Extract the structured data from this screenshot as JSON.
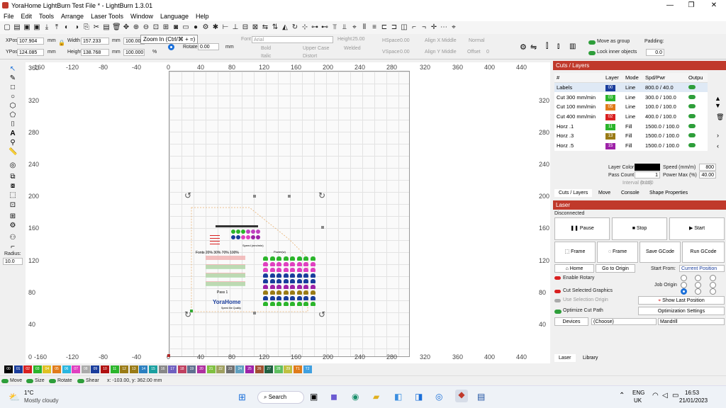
{
  "window": {
    "title": "YoraHome LightBurn Test File * - LightBurn 1.3.01"
  },
  "menu": [
    "File",
    "Edit",
    "Tools",
    "Arrange",
    "Laser Tools",
    "Window",
    "Language",
    "Help"
  ],
  "tooltip": "Zoom In (Ctrl/⌘ + =)",
  "props": {
    "xpos_label": "XPos",
    "xpos": "107.904",
    "ypos_label": "YPos",
    "ypos": "124.085",
    "unit": "mm",
    "width_label": "Width",
    "width": "157.233",
    "height_label": "Height",
    "height": "138.768",
    "pct1": "100.000",
    "pct2": "100.000",
    "pct_sign": "%",
    "rotate_label": "Rotate",
    "rotate": "0.00",
    "font_label": "Font",
    "font": "Arial",
    "height2_label": "Height",
    "height2": "25.00",
    "bold": "Bold",
    "italic": "Italic",
    "uppercase": "Upper Case",
    "distort": "Distort",
    "welded": "Welded",
    "hspace_label": "HSpace",
    "hspace": "0.00",
    "vspace_label": "VSpace",
    "vspace": "0.00",
    "alignx_label": "Align X",
    "alignx": "Middle",
    "aligny_label": "Align Y",
    "aligny": "Middle",
    "normal": "Normal",
    "offset_label": "Offset",
    "offset": "0",
    "move_group": "Move as group",
    "lock_inner": "Lock inner objects",
    "padding_label": "Padding:",
    "padding": "0.0"
  },
  "left_tools": {
    "radius_label": "Radius:",
    "radius": "10.0"
  },
  "rulers": {
    "top": [
      "160",
      "-120",
      "-80",
      "-40",
      "0",
      "40",
      "80",
      "120",
      "160",
      "200",
      "240",
      "280",
      "320",
      "360",
      "400",
      "440"
    ],
    "left": [
      "360",
      "320",
      "280",
      "240",
      "200",
      "160",
      "120",
      "80",
      "40",
      "0"
    ],
    "bottom": [
      "-160",
      "-120",
      "-80",
      "-40",
      "0",
      "40",
      "80",
      "120",
      "160",
      "200",
      "240",
      "280",
      "320",
      "360",
      "400",
      "440"
    ],
    "right": [
      "320",
      "280",
      "240",
      "200",
      "160",
      "120",
      "80",
      "40"
    ]
  },
  "canvas_text": {
    "fonts_title": "Fonts  20%  30%  70%  100%",
    "speed_title": "Speed (mm/min)",
    "line_title": "Power(w)",
    "logo": "YoraHome",
    "logo_sub": "Speed the Quality",
    "pass": "Pass 1"
  },
  "cuts_layers": {
    "title": "Cuts / Layers",
    "headers": [
      "#",
      "Layer",
      "Mode",
      "Spd/Pwr",
      "Outpu"
    ],
    "rows": [
      {
        "name": "Labels",
        "num": "00",
        "color": "#1a3d9c",
        "mode": "Line",
        "spd": "800.0 / 40.0"
      },
      {
        "name": "Cut 300 mm/min",
        "num": "03",
        "color": "#2bb52b",
        "mode": "Line",
        "spd": "300.0 / 100.0"
      },
      {
        "name": "Cut 100 mm/min",
        "num": "05",
        "color": "#e07b1a",
        "mode": "Line",
        "spd": "100.0 / 100.0"
      },
      {
        "name": "Cut 400 mm/min",
        "num": "02",
        "color": "#d92020",
        "mode": "Line",
        "spd": "400.0 / 100.0"
      },
      {
        "name": "Horz .1",
        "num": "11",
        "color": "#2bb52b",
        "mode": "Fill",
        "spd": "1500.0 / 100.0"
      },
      {
        "name": "Horz .3",
        "num": "13",
        "color": "#9a7b16",
        "mode": "Fill",
        "spd": "1500.0 / 100.0"
      },
      {
        "name": "Horz .5",
        "num": "15",
        "color": "#9e22a8",
        "mode": "Fill",
        "spd": "1500.0 / 100.0"
      }
    ],
    "layer_color_label": "Layer Color",
    "speed_label": "Speed (mm/m)",
    "speed": "800",
    "pass_label": "Pass Count",
    "pass": "1",
    "power_label": "Power Max (%)",
    "power": "40.00",
    "interval_label": "Interval (mm)",
    "interval": "0.100",
    "tabs": [
      "Cuts / Layers",
      "Move",
      "Console",
      "Shape Properties"
    ]
  },
  "laser": {
    "title": "Laser",
    "status": "Disconnected",
    "pause": "Pause",
    "stop": "Stop",
    "start": "Start",
    "frame1": "Frame",
    "frame2": "Frame",
    "save_gcode": "Save GCode",
    "run_gcode": "Run GCode",
    "home": "Home",
    "goto_origin": "Go to Origin",
    "start_from_label": "Start From:",
    "start_from": "Current Position",
    "enable_rotary": "Enable Rotary",
    "job_origin": "Job Origin",
    "cut_selected": "Cut Selected Graphics",
    "use_selection": "Use Selection Origin",
    "show_last": "Show Last Position",
    "optimize": "Optimize Cut Path",
    "opt_settings": "Optimization Settings",
    "devices": "Devices",
    "choose": "(Choose)",
    "device": "Mandrill",
    "tabs": [
      "Laser",
      "Library"
    ]
  },
  "palette": [
    "00",
    "01",
    "02",
    "03",
    "04",
    "05",
    "06",
    "07",
    "08",
    "09",
    "10",
    "11",
    "12",
    "13",
    "14",
    "15",
    "16",
    "17",
    "18",
    "19",
    "20",
    "21",
    "22",
    "23",
    "24",
    "25",
    "26",
    "27",
    "28",
    "29",
    "T1",
    "T2"
  ],
  "palette_colors": [
    "#000",
    "#1a3d9c",
    "#d92020",
    "#2bb52b",
    "#e0c020",
    "#e07b1a",
    "#2ab7e0",
    "#e040c0",
    "#aaa",
    "#1a3d9c",
    "#b01010",
    "#2bb52b",
    "#9a7b16",
    "#9a7b16",
    "#2a7fc0",
    "#1aa0a0",
    "#888",
    "#7060c0",
    "#c04060",
    "#607090",
    "#b030a0",
    "#80c040",
    "#a0a060",
    "#707070",
    "#60a0c0",
    "#9e22a8",
    "#a05030",
    "#206040",
    "#60c060",
    "#c0c040",
    "#e07b1a",
    "#40a0e0"
  ],
  "status": {
    "move": "Move",
    "size": "Size",
    "rotate": "Rotate",
    "shear": "Shear",
    "coords": "x: -103.00, y: 362.00 mm"
  },
  "taskbar": {
    "temp": "1°C",
    "weather": "Mostly cloudy",
    "search": "Search",
    "lang1": "ENG",
    "lang2": "UK",
    "time": "16:53",
    "date": "21/01/2023"
  }
}
